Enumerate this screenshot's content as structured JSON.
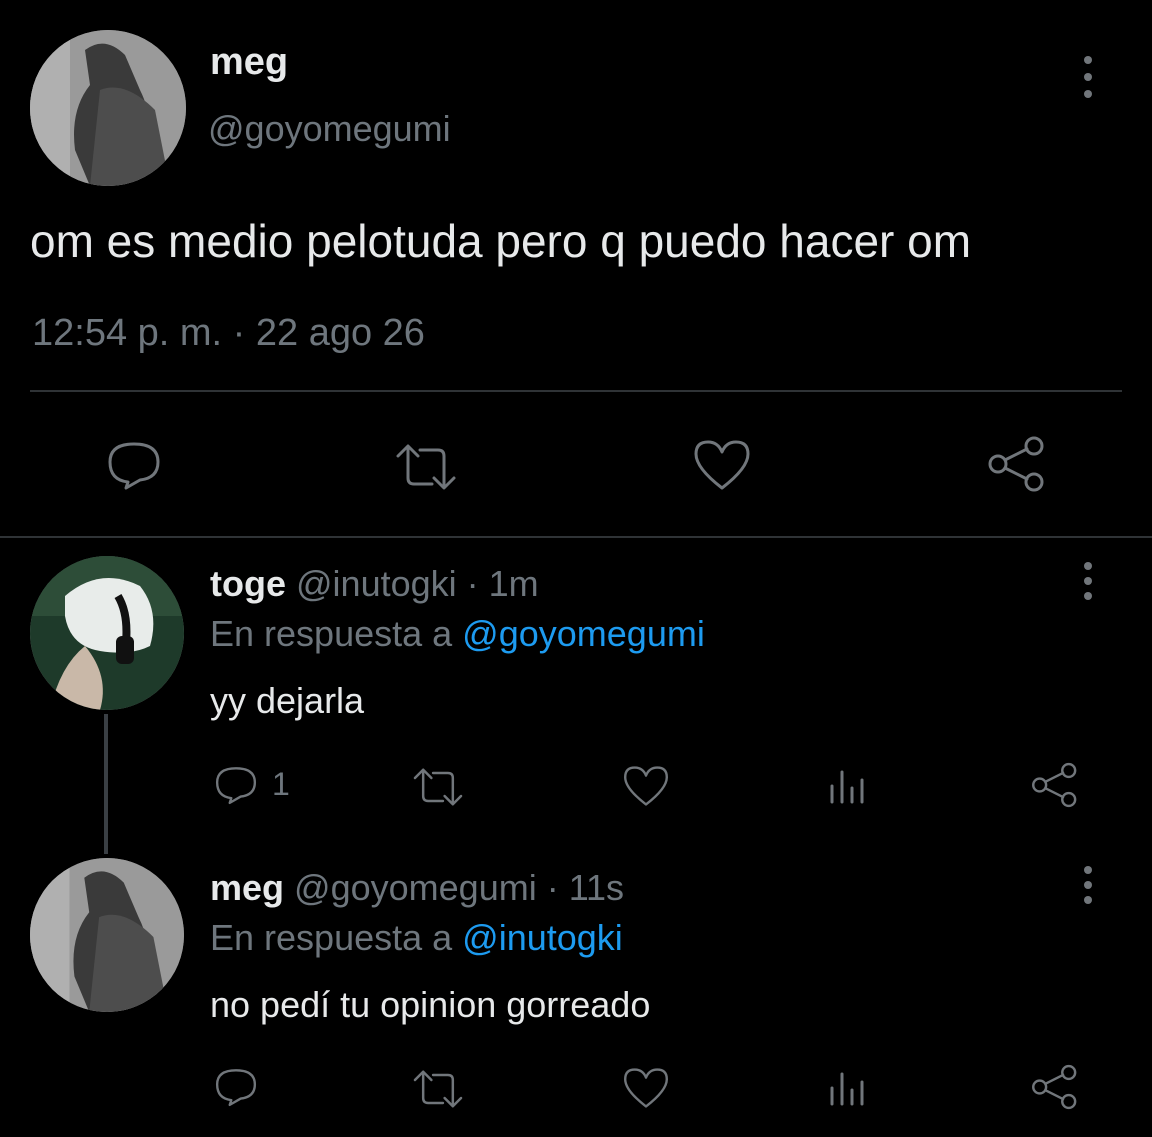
{
  "main_tweet": {
    "display_name": "meg",
    "handle": "@goyomegumi",
    "text": "om es medio pelotuda pero q puedo hacer om",
    "timestamp": "12:54 p. m. · 22 ago 26"
  },
  "replies": [
    {
      "display_name": "toge",
      "handle_time": "@inutogki · 1m",
      "replying_prefix": "En respuesta a",
      "replying_to": "@goyomegumi",
      "text": "yy dejarla",
      "reply_count": "1"
    },
    {
      "display_name": "meg",
      "handle_time": "@goyomegumi · 11s",
      "replying_prefix": "En respuesta a",
      "replying_to": "@inutogki",
      "text": "no pedí tu opinion gorreado",
      "reply_count": ""
    }
  ],
  "colors": {
    "background": "#000000",
    "text_primary": "#e7e9ea",
    "text_muted": "#6e767d",
    "link": "#1d9bf0",
    "divider": "#2f3336"
  }
}
